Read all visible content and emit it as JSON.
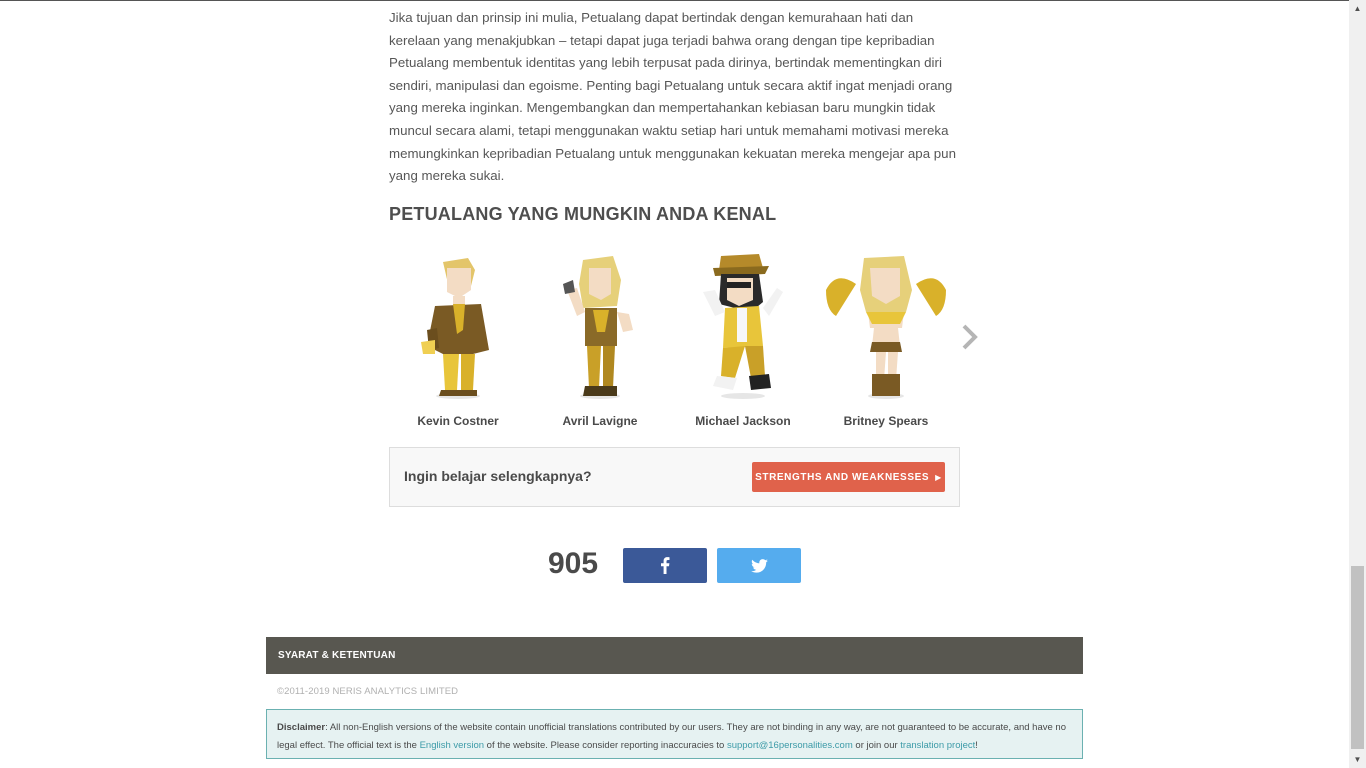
{
  "article": {
    "paragraph": "Jika tujuan dan prinsip ini mulia, Petualang dapat bertindak dengan kemurahaan hati dan kerelaan yang menakjubkan – tetapi dapat juga terjadi bahwa orang dengan tipe kepribadian Petualang membentuk identitas yang lebih terpusat pada dirinya, bertindak mementingkan diri sendiri, manipulasi dan egoisme. Penting bagi Petualang untuk secara aktif ingat menjadi orang yang mereka inginkan. Mengembangkan dan mempertahankan kebiasan baru mungkin tidak muncul secara alami, tetapi menggunakan waktu setiap hari untuk memahami motivasi mereka memungkinkan kepribadian Petualang untuk menggunakan kekuatan mereka mengejar apa pun yang mereka sukai."
  },
  "section_title": "PETUALANG YANG MUNGKIN ANDA KENAL",
  "people": [
    {
      "name": "Kevin Costner",
      "icon": "kevin-costner-illustration"
    },
    {
      "name": "Avril Lavigne",
      "icon": "avril-lavigne-illustration"
    },
    {
      "name": "Michael Jackson",
      "icon": "michael-jackson-illustration"
    },
    {
      "name": "Britney Spears",
      "icon": "britney-spears-illustration"
    }
  ],
  "learn_more": {
    "text": "Ingin belajar selengkapnya?",
    "button_label": "STRENGTHS AND WEAKNESSES"
  },
  "share": {
    "count": "905",
    "facebook_icon": "facebook-icon",
    "twitter_icon": "twitter-icon"
  },
  "footer": {
    "terms_label": "SYARAT & KETENTUAN",
    "copyright": "©2011-2019 NERIS ANALYTICS LIMITED"
  },
  "disclaimer": {
    "label": "Disclaimer",
    "text1": ": All non-English versions of the website contain unofficial translations contributed by our users. They are not binding in any way, are not guaranteed to be accurate, and have no legal effect. The official text is the ",
    "link1": "English version",
    "text2": " of the website. Please consider reporting inaccuracies to ",
    "link2": "support@16personalities.com",
    "text3": " or join our ",
    "link3": "translation project",
    "text4": "!"
  },
  "colors": {
    "button_accent": "#e0624b",
    "facebook": "#3b5998",
    "twitter": "#55acee",
    "footer_bar": "#585750",
    "disclaimer_bg": "#e6f2f2",
    "disclaimer_link": "#3d9ba8",
    "figure_gold": "#d9b12a"
  }
}
